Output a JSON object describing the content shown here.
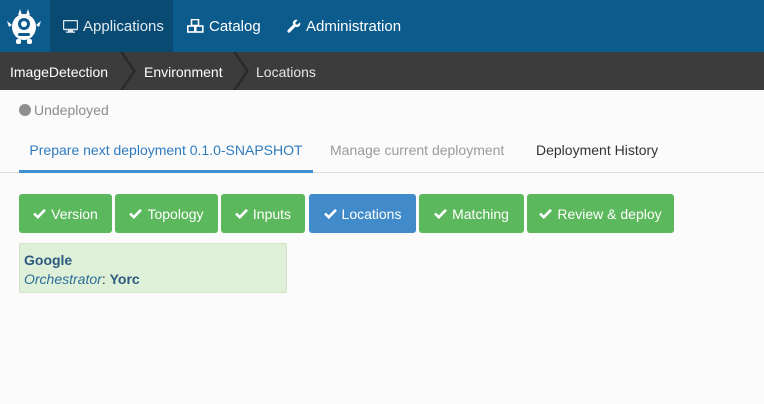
{
  "navbar": {
    "items": [
      {
        "label": "Applications",
        "icon": "monitor-icon",
        "active": true
      },
      {
        "label": "Catalog",
        "icon": "cubes-icon",
        "active": false
      },
      {
        "label": "Administration",
        "icon": "wrench-icon",
        "active": false
      }
    ]
  },
  "breadcrumb": {
    "items": [
      "ImageDetection",
      "Environment",
      "Locations"
    ]
  },
  "status": {
    "label": "Undeployed"
  },
  "tabs": [
    {
      "label": "Prepare next deployment 0.1.0-SNAPSHOT",
      "active": true
    },
    {
      "label": "Manage current deployment",
      "active": false
    },
    {
      "label": "Deployment History",
      "active": false
    }
  ],
  "steps": [
    {
      "label": "Version",
      "state": "done"
    },
    {
      "label": "Topology",
      "state": "done"
    },
    {
      "label": "Inputs",
      "state": "done"
    },
    {
      "label": "Locations",
      "state": "current"
    },
    {
      "label": "Matching",
      "state": "done"
    },
    {
      "label": "Review & deploy",
      "state": "done"
    }
  ],
  "location": {
    "name": "Google",
    "orchestrator_label": "Orchestrator",
    "orchestrator_value": "Yorc"
  },
  "colors": {
    "navbar": "#0b5b8c",
    "breadcrumb": "#3c3c3c",
    "step_done": "#5cb85c",
    "step_current": "#428bca",
    "location_bg": "#dff0d8"
  }
}
